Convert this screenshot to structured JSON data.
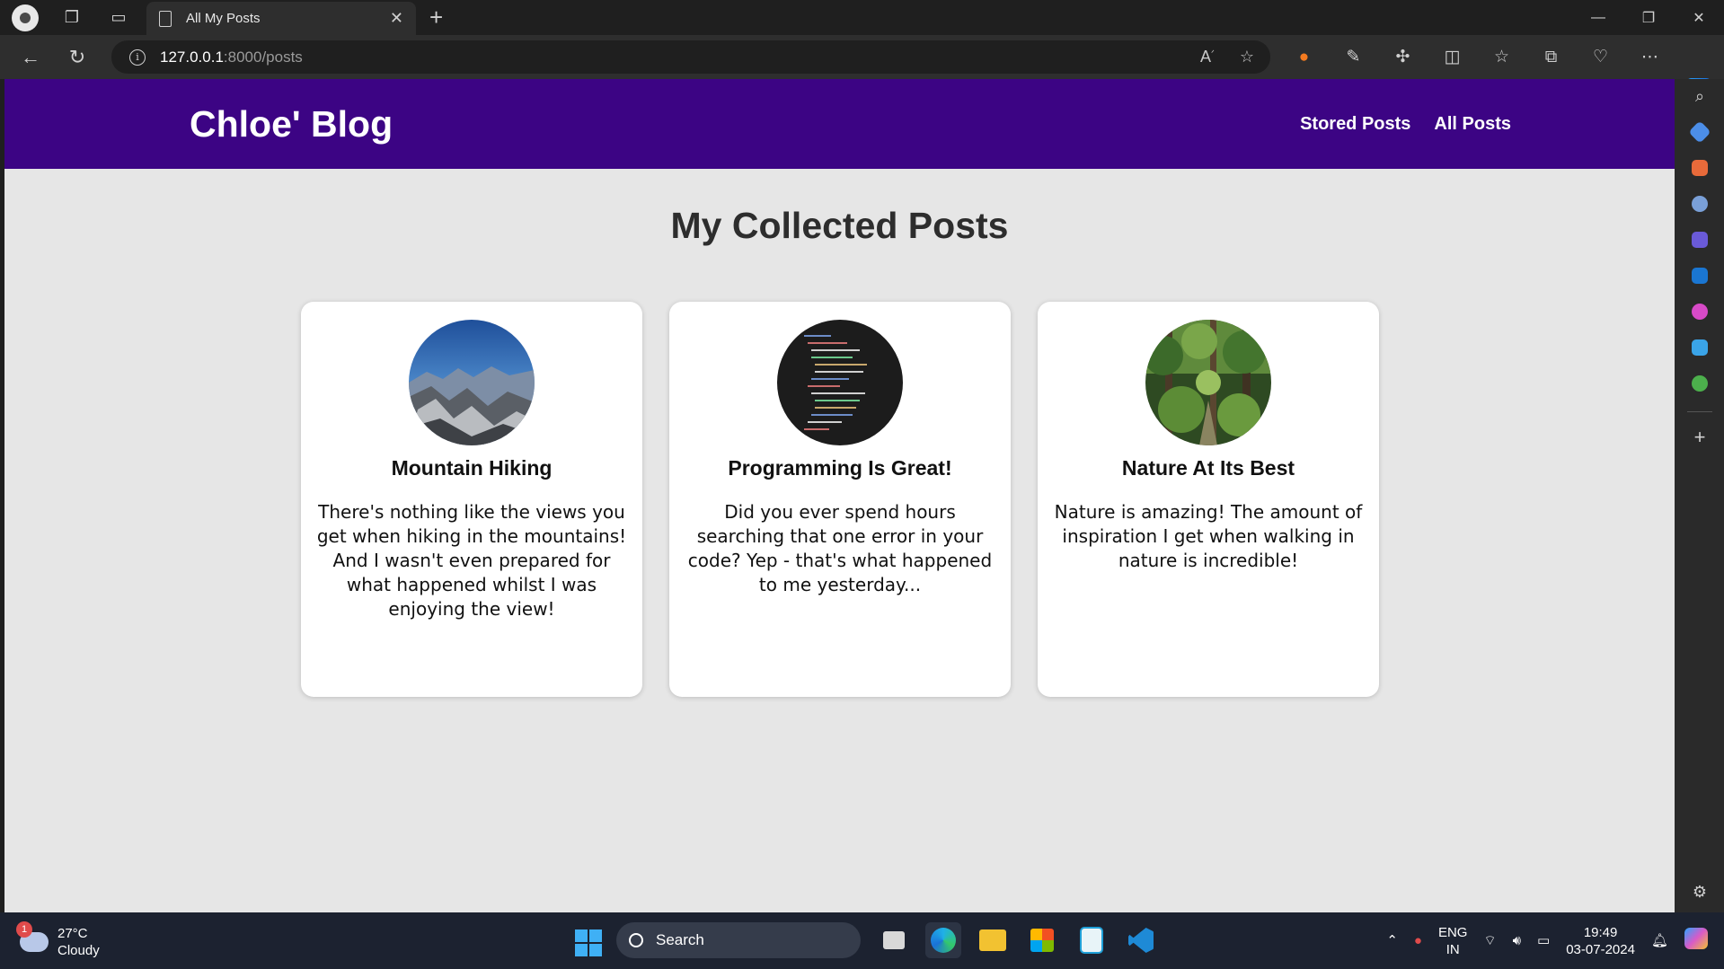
{
  "browser": {
    "tab_title": "All My Posts",
    "url_host": "127.0.0.1",
    "url_path": ":8000/posts"
  },
  "site": {
    "title": "Chloe' Blog",
    "nav": [
      "Stored Posts",
      "All Posts"
    ],
    "heading": "My Collected Posts",
    "colors": {
      "header": "#3c0484",
      "background": "#e6e6e6"
    }
  },
  "posts": [
    {
      "title": "Mountain Hiking",
      "excerpt": "There's nothing like the views you get when hiking in the mountains! And I wasn't even prepared for what happened whilst I was enjoying the view!",
      "image": "mountain"
    },
    {
      "title": "Programming Is Great!",
      "excerpt": "Did you ever spend hours searching that one error in your code? Yep - that's what happened to me yesterday...",
      "image": "code"
    },
    {
      "title": "Nature At Its Best",
      "excerpt": "Nature is amazing! The amount of inspiration I get when walking in nature is incredible!",
      "image": "forest"
    }
  ],
  "taskbar": {
    "weather_temp": "27°C",
    "weather_desc": "Cloudy",
    "weather_badge": "1",
    "search_label": "Search",
    "lang_top": "ENG",
    "lang_bottom": "IN",
    "time": "19:49",
    "date": "03-07-2024"
  }
}
